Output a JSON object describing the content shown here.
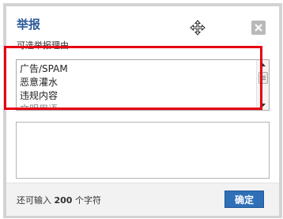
{
  "dialog": {
    "title": "举报",
    "close_icon": "close-icon",
    "move_icon": "move-cursor-icon",
    "prompt": "可选举报理由"
  },
  "reasons": {
    "items": [
      "广告/SPAM",
      "恶意灌水",
      "违规内容"
    ],
    "partial_item": "文明用语"
  },
  "textarea": {
    "value": ""
  },
  "footer": {
    "remain_prefix": "还可输入",
    "remain_count": "200",
    "remain_suffix": "个字符",
    "confirm_label": "确定"
  },
  "colors": {
    "title": "#2b5b9b",
    "highlight_frame": "#e60012",
    "confirm_button": "#2e6fb8",
    "dialog_border": "#d3d3d3"
  }
}
